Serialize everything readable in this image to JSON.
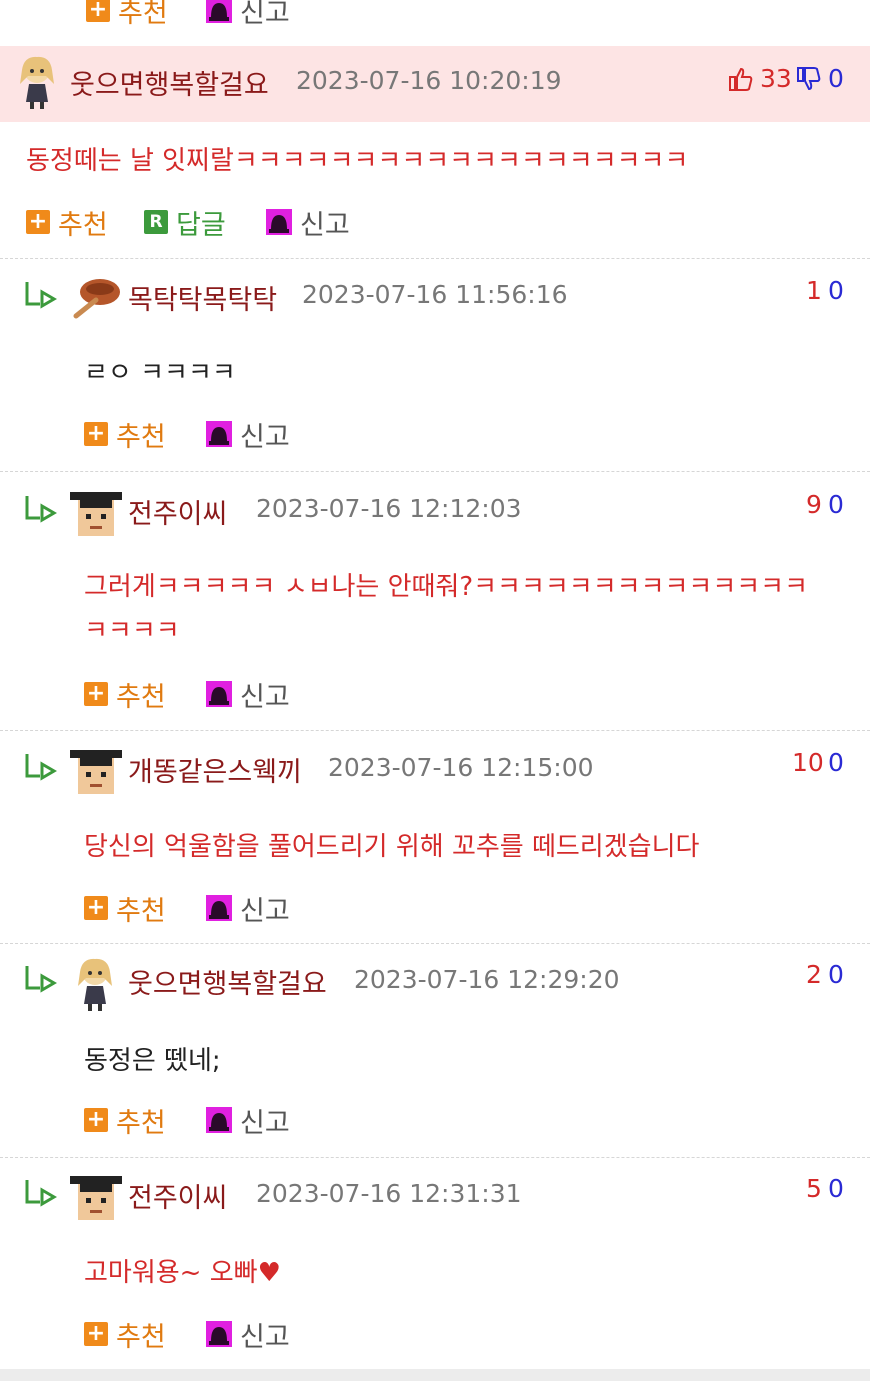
{
  "colors": {
    "accent_red": "#d42a2a",
    "down_blue": "#2a2ad4",
    "header_bg": "#fde4e4",
    "recommend_orange": "#e07a10",
    "reply_green": "#3c9a3c"
  },
  "labels": {
    "recommend": "추천",
    "reply": "답글",
    "report": "신고"
  },
  "main_comment": {
    "nick": "웃으면행복할걸요",
    "time": "2023-07-16 10:20:19",
    "up": "33",
    "down": "0",
    "text": "동정떼는 날 잇찌랄ㅋㅋㅋㅋㅋㅋㅋㅋㅋㅋㅋㅋㅋㅋㅋㅋㅋㅋㅋ"
  },
  "replies": [
    {
      "nick": "목탁탁목탁탁",
      "time": "2023-07-16 11:56:16",
      "up": "1",
      "down": "0",
      "text": "ㄹㅇ ㅋㅋㅋㅋ",
      "avatar": "moktak-icon"
    },
    {
      "nick": "전주이씨",
      "time": "2023-07-16 12:12:03",
      "up": "9",
      "down": "0",
      "text_line1": "그러게ㅋㅋㅋㅋㅋ ㅅㅂ나는 안때줘?ㅋㅋㅋㅋㅋㅋㅋㅋㅋㅋㅋㅋㅋㅋ",
      "text_line2": "ㅋㅋㅋㅋ",
      "avatar": "grad-cap-avatar-icon"
    },
    {
      "nick": "개똥같은스웩끼",
      "time": "2023-07-16 12:15:00",
      "up": "10",
      "down": "0",
      "text": "당신의 억울함을 풀어드리기 위해 꼬추를 떼드리겠습니다",
      "avatar": "grad-cap-avatar-icon"
    },
    {
      "nick": "웃으면행복할걸요",
      "time": "2023-07-16 12:29:20",
      "up": "2",
      "down": "0",
      "text": "동정은 뗐네;",
      "avatar": "anime-girl-icon"
    },
    {
      "nick": "전주이씨",
      "time": "2023-07-16 12:31:31",
      "up": "5",
      "down": "0",
      "text": "고마워용~ 오빠♥",
      "avatar": "grad-cap-avatar-icon"
    }
  ]
}
